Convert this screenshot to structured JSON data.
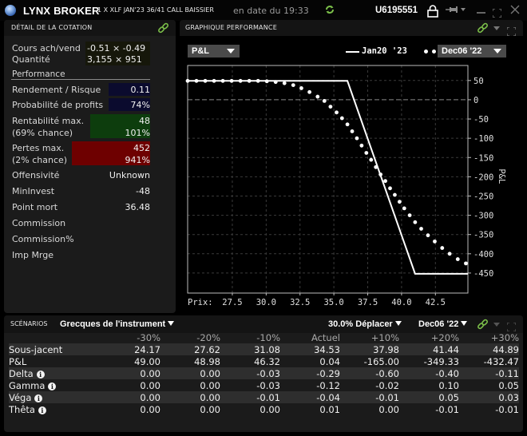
{
  "titlebar": {
    "brand": "LYNX BROKER",
    "instrument": "1 X XLF JAN'23 36/41 CALL BAISSIER",
    "datetime": "en date du 19:33",
    "account": "U6195551"
  },
  "quote_panel": {
    "title": "DÉTAIL DE LA COTATION",
    "bid_ask_label": "Cours ach/vend",
    "bid_ask_value": "-0.51 × -0.49",
    "size_label": "Quantité",
    "size_value": "3,155 × 951",
    "performance_heading": "Performance",
    "reward_risk_label": "Rendement / Risque",
    "reward_risk_value": "0.11",
    "prob_profit_label": "Probabilité de profits",
    "prob_profit_value": "74%",
    "max_profit_label": "Rentabilité max.",
    "max_profit_chance": "(69% chance)",
    "max_profit_value": "48",
    "max_profit_pct": "101%",
    "max_loss_label": "Pertes max.",
    "max_loss_chance": "(2% chance)",
    "max_loss_value": "452",
    "max_loss_pct": "941%",
    "aggressiveness_label": "Offensivité",
    "aggressiveness_value": "Unknown",
    "min_invest_label": "MinInvest",
    "min_invest_value": "-48",
    "breakeven_label": "Point mort",
    "breakeven_value": "36.48",
    "commission_label": "Commission",
    "commission_pct_label": "Commission%",
    "margin_label": "Imp Mrge"
  },
  "chart_panel": {
    "title": "GRAPHIQUE PERFORMANCE",
    "metric_dropdown": "P&L",
    "date_dropdown": "Dec06 '22"
  },
  "chart_data": {
    "type": "line",
    "title": "",
    "xlabel": "Prix:",
    "ylabel": "P&L",
    "x_ticks": [
      27.5,
      30.0,
      32.5,
      35.0,
      37.5,
      40.0,
      42.5
    ],
    "x_tick_labels": [
      "27.5",
      "30.0",
      "32.5",
      "35.0",
      "37.5",
      "40.0",
      "42.5"
    ],
    "y_ticks": [
      50,
      0,
      -50,
      -100,
      -150,
      -200,
      -250,
      -300,
      -350,
      -400,
      -450
    ],
    "y_tick_labels": [
      "50",
      "0",
      "-50",
      "-100",
      "-150",
      "-200",
      "-250",
      "-300",
      "-350",
      "-400",
      "-450"
    ],
    "xlim": [
      24.2,
      44.9
    ],
    "ylim": [
      -502,
      89
    ],
    "grid": true,
    "legend_position": "top-right",
    "series": [
      {
        "name": "Jan20 '23",
        "style": "solid",
        "x": [
          24.2,
          36.0,
          41.0,
          44.9
        ],
        "y": [
          49,
          49,
          -452,
          -452
        ]
      },
      {
        "name": "Dec06 '22",
        "style": "dotted",
        "x": [
          24.2,
          24.85,
          25.5,
          26.15,
          26.8,
          27.45,
          28.1,
          28.75,
          29.4,
          30.05,
          30.7,
          31.35,
          32.0,
          32.6,
          33.2,
          33.8,
          34.3,
          34.75,
          35.2,
          35.6,
          36.0,
          36.35,
          36.7,
          37.05,
          37.4,
          37.75,
          38.1,
          38.45,
          38.8,
          39.15,
          39.5,
          39.85,
          40.2,
          40.6,
          41.0,
          41.45,
          41.95,
          42.45,
          43.0,
          43.55,
          44.15,
          44.75
        ],
        "y": [
          49,
          49,
          49,
          49,
          49,
          49,
          49,
          49,
          49,
          48,
          46,
          43,
          38,
          30,
          20,
          8,
          -3,
          -18,
          -33,
          -48,
          -64,
          -82,
          -100,
          -119,
          -138,
          -156,
          -175,
          -194,
          -211,
          -230,
          -247,
          -265,
          -282,
          -300,
          -318,
          -335,
          -352,
          -368,
          -385,
          -400,
          -414,
          -425
        ]
      }
    ]
  },
  "scenarios": {
    "title": "SCÉNARIOS",
    "view_dropdown": "Grecques de l'instrument",
    "move_dropdown": "30.0% Déplacer",
    "date_dropdown": "Dec06 '22",
    "columns": [
      "-30%",
      "-20%",
      "-10%",
      "Actuel",
      "+10%",
      "+20%",
      "+30%"
    ],
    "rows": [
      {
        "label": "Sous-jacent",
        "info": false,
        "values": [
          "24.17",
          "27.62",
          "31.08",
          "34.53",
          "37.98",
          "41.44",
          "44.89"
        ]
      },
      {
        "label": "P&L",
        "info": false,
        "values": [
          "49.00",
          "48.98",
          "46.32",
          "0.04",
          "-165.00",
          "-349.33",
          "-432.47"
        ]
      },
      {
        "label": "Delta",
        "info": true,
        "values": [
          "0.00",
          "0.00",
          "-0.03",
          "-0.29",
          "-0.60",
          "-0.40",
          "-0.11"
        ]
      },
      {
        "label": "Gamma",
        "info": true,
        "values": [
          "0.00",
          "0.00",
          "-0.03",
          "-0.12",
          "-0.02",
          "0.10",
          "0.05"
        ]
      },
      {
        "label": "Véga",
        "info": true,
        "values": [
          "0.00",
          "0.00",
          "-0.01",
          "-0.04",
          "-0.01",
          "0.05",
          "0.03"
        ]
      },
      {
        "label": "Thêta",
        "info": true,
        "values": [
          "0.00",
          "0.00",
          "0.00",
          "0.01",
          "0.00",
          "-0.01",
          "-0.01"
        ]
      }
    ]
  },
  "colors": {
    "accent_green": "#7cc04a",
    "profit_bg": "#0d3d0d",
    "loss_bg": "#6e0000",
    "metric_bg": "#0b0b2e"
  }
}
